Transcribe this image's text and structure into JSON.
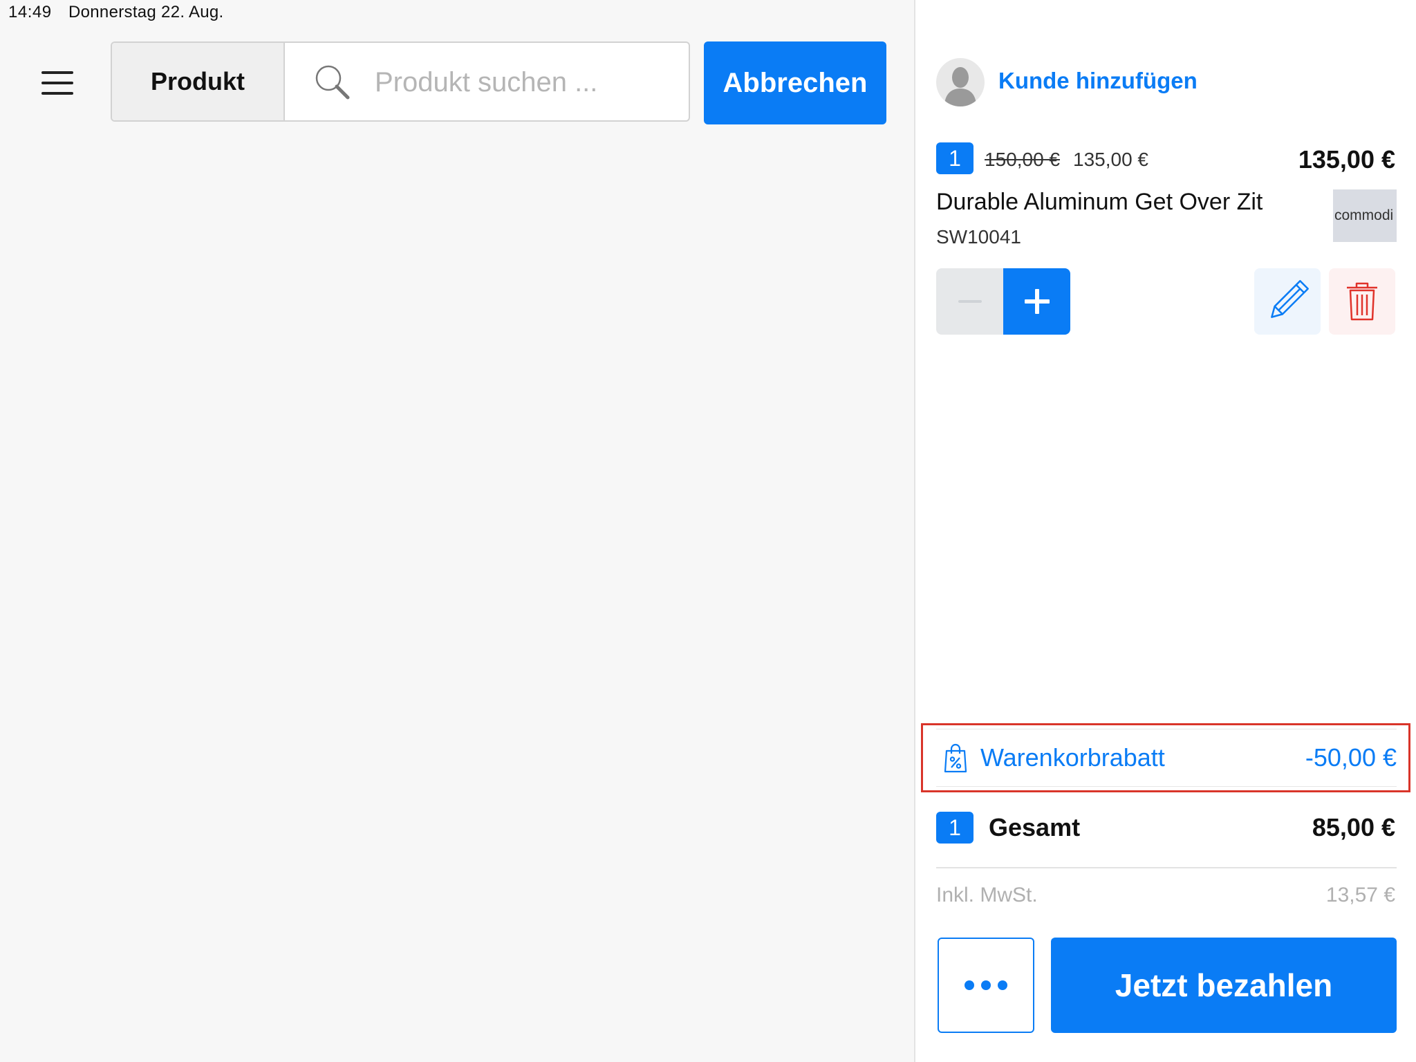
{
  "status_bar": {
    "time": "14:49",
    "date": "Donnerstag 22. Aug.",
    "icons": [
      "wifi-icon",
      "battery-charging-icon"
    ]
  },
  "toolbar": {
    "menu_icon": "hamburger-menu-icon",
    "filter_label": "Produkt",
    "search_icon": "search-icon",
    "search_placeholder": "Produkt suchen ...",
    "search_value": "",
    "cancel_label": "Abbrechen"
  },
  "cart": {
    "customer": {
      "avatar_icon": "user-avatar-icon",
      "add_label": "Kunde hinzufügen"
    },
    "items": [
      {
        "quantity": "1",
        "original_price": "150,00 €",
        "unit_price": "135,00 €",
        "line_total": "135,00 €",
        "name": "Durable Aluminum Get Over Zit",
        "sku": "SW10041",
        "thumbnail_text": "commodi",
        "actions": {
          "decrease_icon": "minus-icon",
          "increase_icon": "plus-icon",
          "edit_icon": "pencil-icon",
          "delete_icon": "trash-icon"
        }
      }
    ],
    "discount": {
      "icon": "shopping-bag-percent-icon",
      "label": "Warenkorbrabatt",
      "value": "-50,00 €"
    },
    "summary": {
      "item_count": "1",
      "total_label": "Gesamt",
      "total_value": "85,00 €",
      "tax_label": "Inkl. MwSt.",
      "tax_value": "13,57 €"
    },
    "footer": {
      "more_icon": "more-dots-icon",
      "pay_label": "Jetzt bezahlen"
    }
  },
  "colors": {
    "accent": "#0a7cf5",
    "highlight_border": "#d9352a",
    "delete_red": "#e0332b",
    "background": "#f7f7f7"
  }
}
